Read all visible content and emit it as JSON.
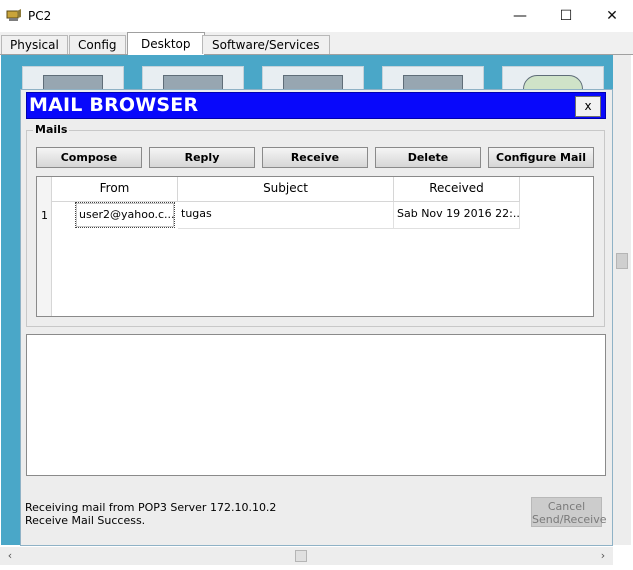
{
  "window": {
    "title": "PC2",
    "minimize_glyph": "—",
    "maximize_glyph": "☐",
    "close_glyph": "✕"
  },
  "tabs": [
    {
      "label": "Physical"
    },
    {
      "label": "Config"
    },
    {
      "label": "Desktop",
      "active": true
    },
    {
      "label": "Software/Services"
    }
  ],
  "mail_browser": {
    "title": "MAIL BROWSER",
    "close_label": "x",
    "group_label": "Mails",
    "buttons": {
      "compose": "Compose",
      "reply": "Reply",
      "receive": "Receive",
      "delete": "Delete",
      "configure": "Configure Mail"
    },
    "table": {
      "headers": {
        "from": "From",
        "subject": "Subject",
        "received": "Received"
      },
      "rows": [
        {
          "num": "1",
          "from": "user2@yahoo.c...",
          "subject": "tugas",
          "received": "Sab Nov 19 2016 22:..."
        }
      ]
    },
    "status": {
      "line1": "Receiving mail from POP3 Server 172.10.10.2",
      "line2": "Receive Mail Success."
    },
    "cancel_button": {
      "line1": "Cancel",
      "line2": "Send/Receive"
    }
  },
  "scrollbars": {
    "left_arrow": "‹",
    "right_arrow": "›"
  },
  "colors": {
    "desktop_bg": "#4aa7c8",
    "header_blue": "#0808fb"
  }
}
